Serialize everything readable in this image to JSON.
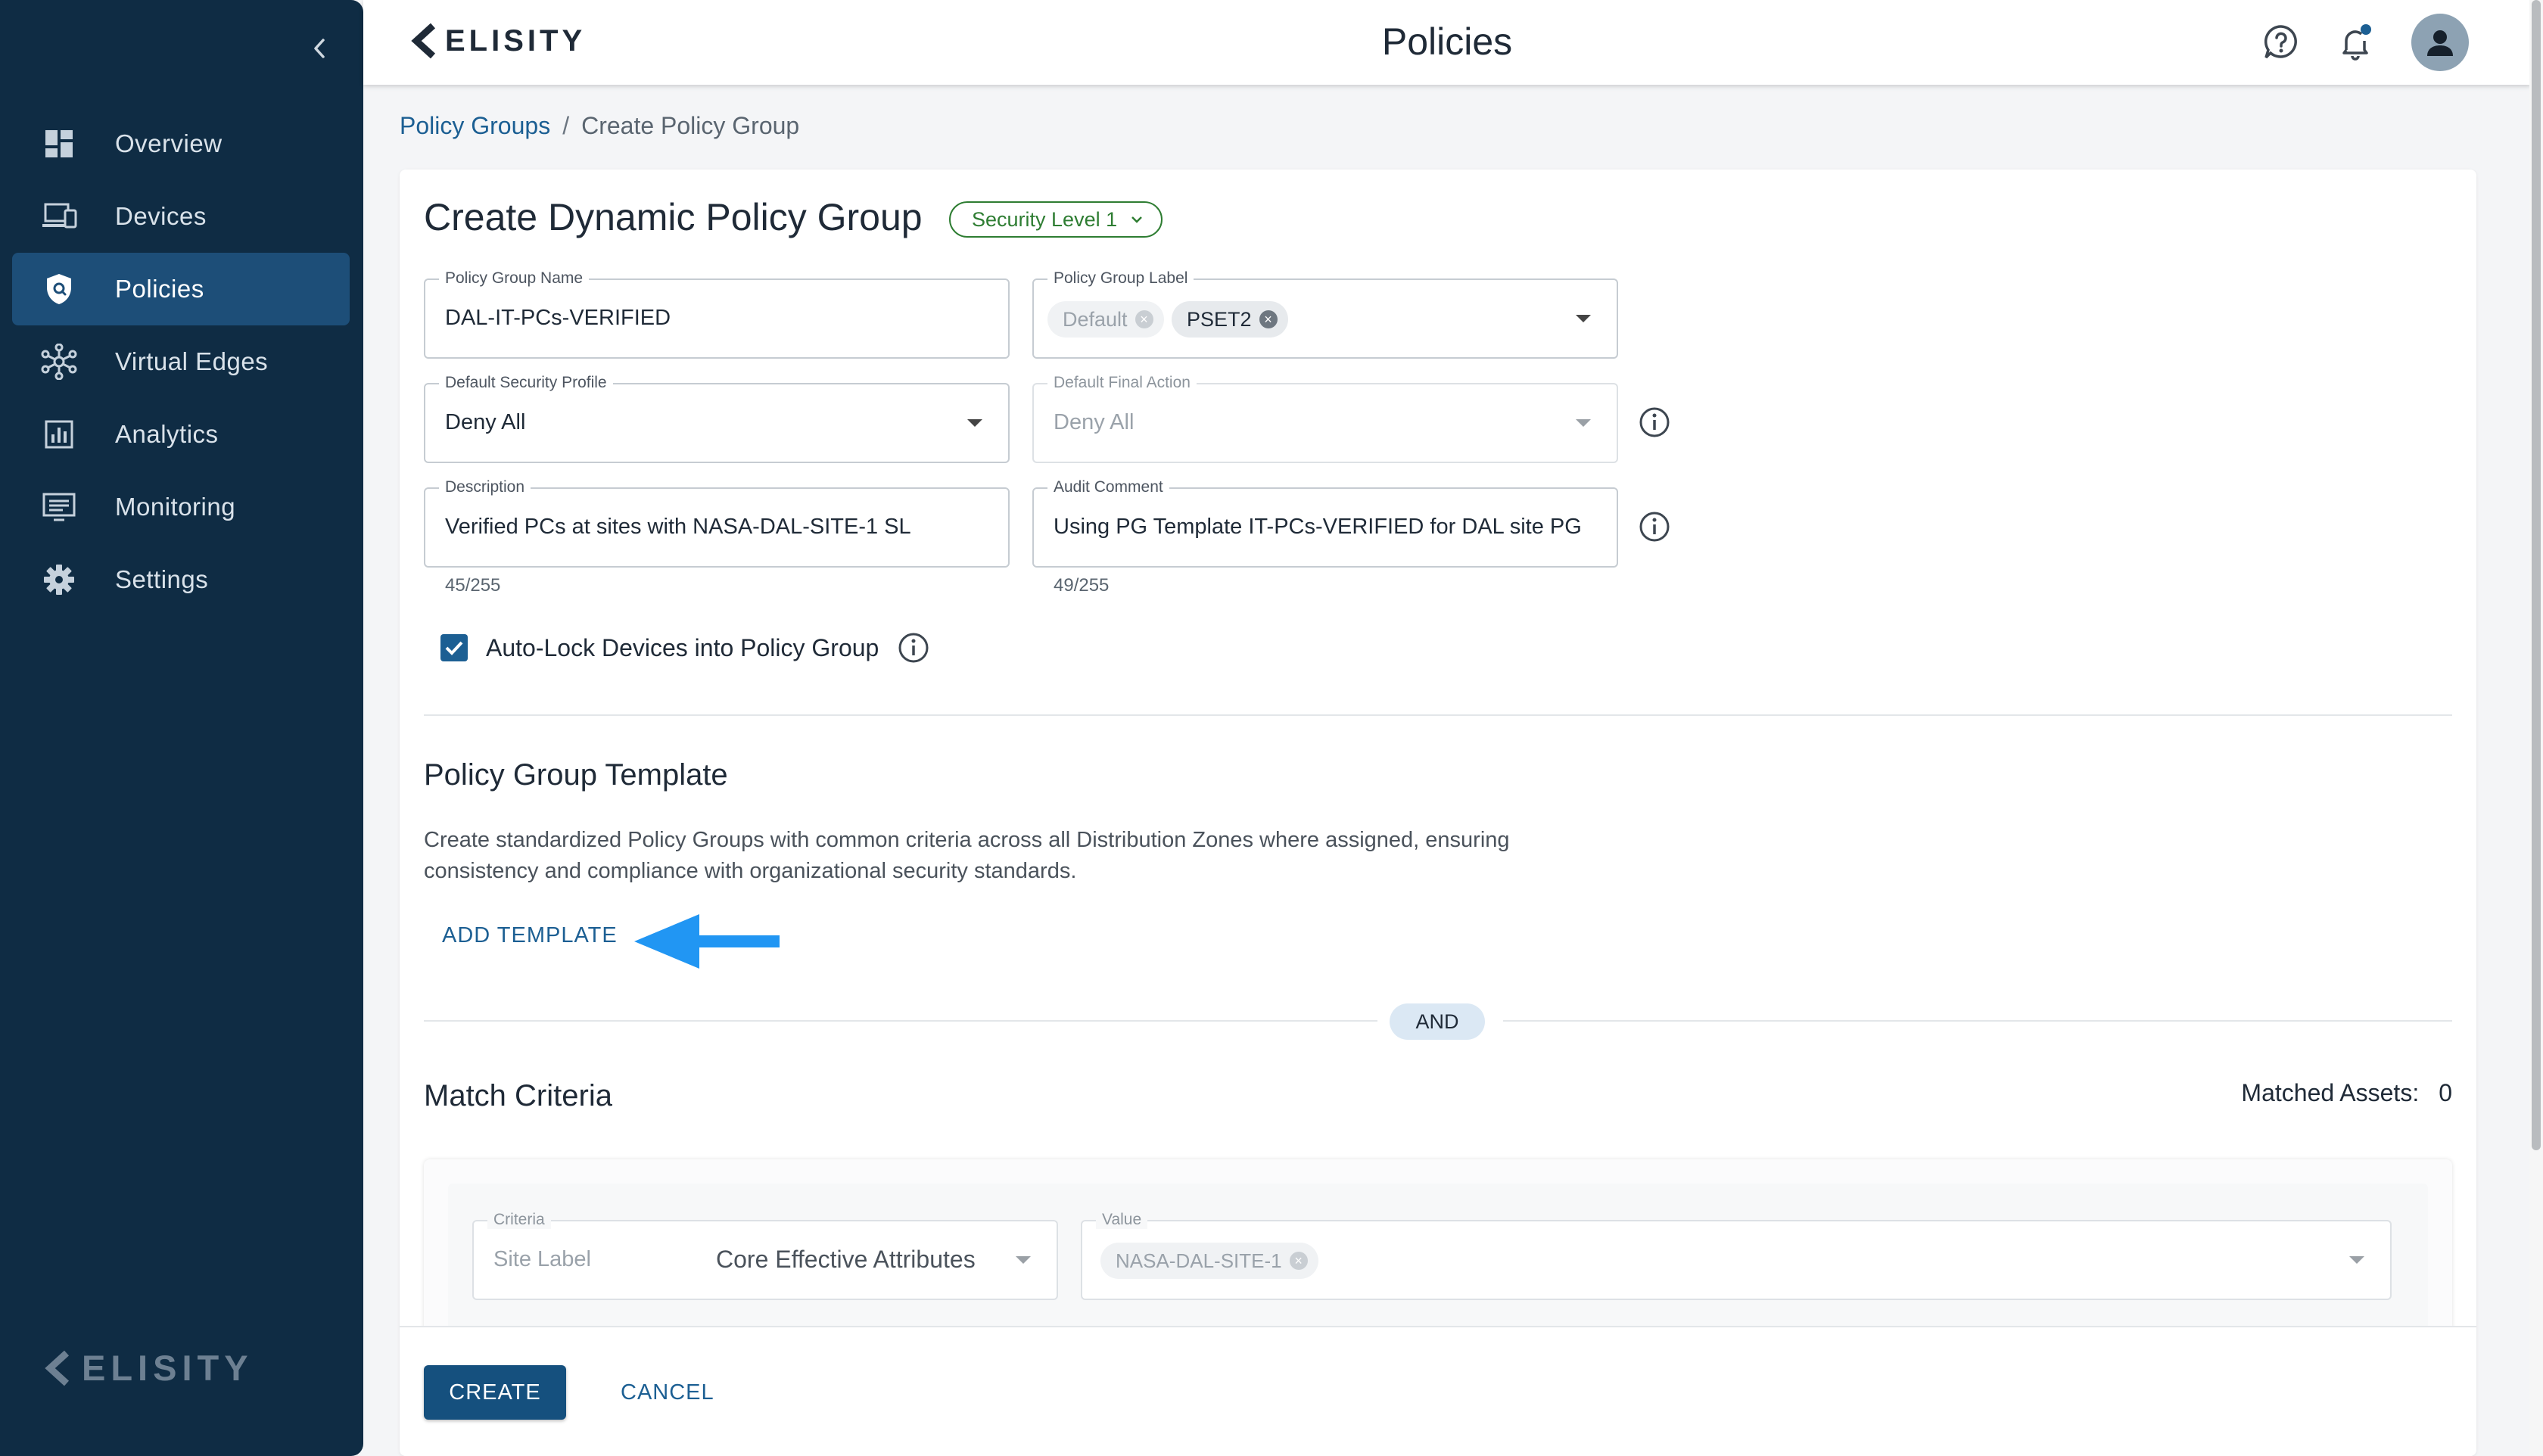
{
  "sidebar": {
    "items": [
      {
        "label": "Overview",
        "icon": "dashboard-icon"
      },
      {
        "label": "Devices",
        "icon": "devices-icon"
      },
      {
        "label": "Policies",
        "icon": "shield-icon"
      },
      {
        "label": "Virtual Edges",
        "icon": "network-nodes-icon"
      },
      {
        "label": "Analytics",
        "icon": "analytics-icon"
      },
      {
        "label": "Monitoring",
        "icon": "monitor-icon"
      },
      {
        "label": "Settings",
        "icon": "gear-icon"
      }
    ],
    "active": "Policies",
    "logo_text": "ELISITY"
  },
  "topbar": {
    "logo_text": "ELISITY",
    "title": "Policies",
    "notification_dot_color": "#1c5f93"
  },
  "breadcrumb": {
    "link": "Policy Groups",
    "separator": "/",
    "current": "Create Policy Group"
  },
  "form": {
    "title": "Create Dynamic Policy Group",
    "security_level": "Security Level 1",
    "policy_group_name": {
      "label": "Policy Group Name",
      "value": "DAL-IT-PCs-VERIFIED"
    },
    "policy_group_label": {
      "label": "Policy Group Label",
      "tags": [
        "Default",
        "PSET2"
      ]
    },
    "default_security_profile": {
      "label": "Default Security Profile",
      "value": "Deny All"
    },
    "default_final_action": {
      "label": "Default Final Action",
      "value": "Deny All"
    },
    "description": {
      "label": "Description",
      "value": "Verified PCs at sites with NASA-DAL-SITE-1 SL",
      "counter": "45/255"
    },
    "audit_comment": {
      "label": "Audit Comment",
      "value": "Using PG Template IT-PCs-VERIFIED for DAL site PG",
      "counter": "49/255"
    },
    "auto_lock": {
      "label": "Auto-Lock Devices into Policy Group",
      "checked": true
    }
  },
  "template_section": {
    "title": "Policy Group Template",
    "description": "Create standardized Policy Groups with common criteria across all Distribution Zones where assigned, ensuring consistency and compliance with organizational security standards.",
    "add_label": "ADD TEMPLATE"
  },
  "and_label": "AND",
  "match_criteria": {
    "title": "Match Criteria",
    "matched_label": "Matched Assets:",
    "matched_count": "0",
    "criteria": {
      "label": "Criteria",
      "key": "Site Label",
      "value": "Core Effective Attributes"
    },
    "value_field": {
      "label": "Value",
      "tags": [
        "NASA-DAL-SITE-1"
      ]
    }
  },
  "actions": {
    "create": "CREATE",
    "cancel": "CANCEL"
  },
  "colors": {
    "sidebar_bg": "#0f2c44",
    "sidebar_active": "#1d4e78",
    "primary": "#15507e",
    "link": "#1c5f93",
    "security_chip": "#2e7d32",
    "annotation_arrow": "#2196f3"
  }
}
